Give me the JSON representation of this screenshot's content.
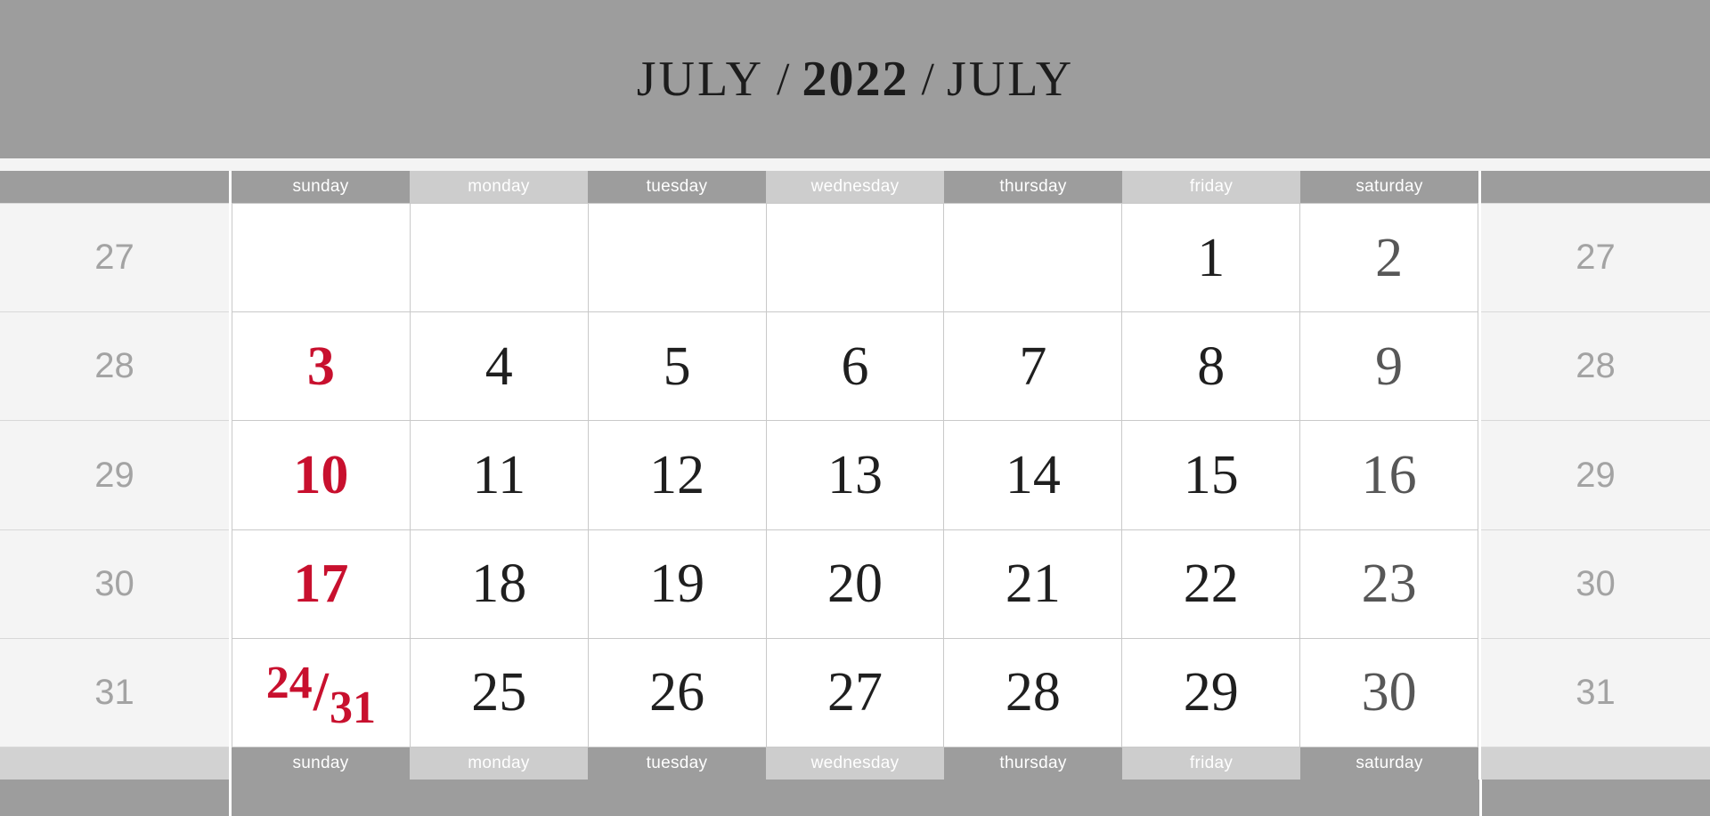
{
  "header": {
    "month_left": "JULY",
    "separator": "/",
    "year": "2022",
    "month_right": "JULY"
  },
  "weekday_labels": [
    {
      "label": "sunday",
      "shade": "dark"
    },
    {
      "label": "monday",
      "shade": "light"
    },
    {
      "label": "tuesday",
      "shade": "dark"
    },
    {
      "label": "wednesday",
      "shade": "light"
    },
    {
      "label": "thursday",
      "shade": "dark"
    },
    {
      "label": "friday",
      "shade": "light"
    },
    {
      "label": "saturday",
      "shade": "dark"
    }
  ],
  "week_numbers_left": [
    "27",
    "28",
    "29",
    "30",
    "31"
  ],
  "week_numbers_right": [
    "27",
    "28",
    "29",
    "30",
    "31"
  ],
  "weeks": [
    [
      {
        "text": "",
        "kind": "empty"
      },
      {
        "text": "",
        "kind": "empty"
      },
      {
        "text": "",
        "kind": "empty"
      },
      {
        "text": "",
        "kind": "empty"
      },
      {
        "text": "",
        "kind": "empty"
      },
      {
        "text": "1",
        "kind": "weekday"
      },
      {
        "text": "2",
        "kind": "saturday"
      }
    ],
    [
      {
        "text": "3",
        "kind": "sunday"
      },
      {
        "text": "4",
        "kind": "weekday"
      },
      {
        "text": "5",
        "kind": "weekday"
      },
      {
        "text": "6",
        "kind": "weekday"
      },
      {
        "text": "7",
        "kind": "weekday"
      },
      {
        "text": "8",
        "kind": "weekday"
      },
      {
        "text": "9",
        "kind": "saturday"
      }
    ],
    [
      {
        "text": "10",
        "kind": "sunday"
      },
      {
        "text": "11",
        "kind": "weekday"
      },
      {
        "text": "12",
        "kind": "weekday"
      },
      {
        "text": "13",
        "kind": "weekday"
      },
      {
        "text": "14",
        "kind": "weekday"
      },
      {
        "text": "15",
        "kind": "weekday"
      },
      {
        "text": "16",
        "kind": "saturday"
      }
    ],
    [
      {
        "text": "17",
        "kind": "sunday"
      },
      {
        "text": "18",
        "kind": "weekday"
      },
      {
        "text": "19",
        "kind": "weekday"
      },
      {
        "text": "20",
        "kind": "weekday"
      },
      {
        "text": "21",
        "kind": "weekday"
      },
      {
        "text": "22",
        "kind": "weekday"
      },
      {
        "text": "23",
        "kind": "saturday"
      }
    ],
    [
      {
        "text": "24/31",
        "kind": "sunday-split",
        "split_first": "24",
        "split_slash": "/",
        "split_second": "31"
      },
      {
        "text": "25",
        "kind": "weekday"
      },
      {
        "text": "26",
        "kind": "weekday"
      },
      {
        "text": "27",
        "kind": "weekday"
      },
      {
        "text": "28",
        "kind": "weekday"
      },
      {
        "text": "29",
        "kind": "weekday"
      },
      {
        "text": "30",
        "kind": "saturday"
      }
    ]
  ],
  "colors": {
    "band_gray": "#9d9d9d",
    "weekday_dark": "#9d9d9d",
    "weekday_light": "#cdcdcd",
    "sunday_red": "#c8102e",
    "saturday_gray": "#575757",
    "weekday_black": "#1f1f1f",
    "week_number_gray": "#a3a3a3",
    "side_column_bg": "#f4f4f4",
    "grid_line": "#c9c9c9"
  }
}
